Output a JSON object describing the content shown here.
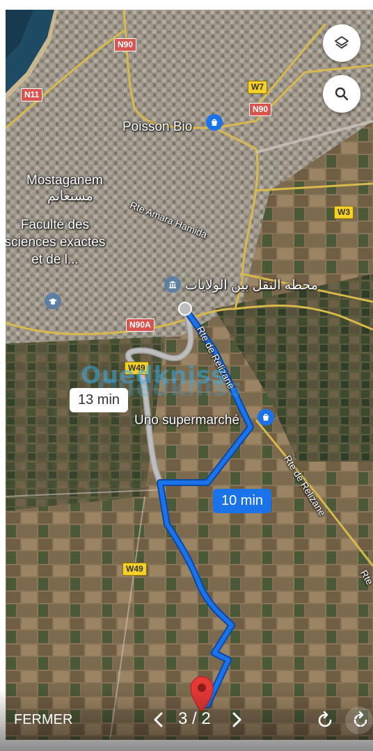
{
  "map": {
    "places": {
      "poisson_bio": "Poisson Bio",
      "mostaganem": "Mostaganem",
      "mostaganem_ar": "مستغانم",
      "faculte": "Faculté des sciences exactes et de l...",
      "gare_ar": "محطة النقل بين الولايات",
      "uno": "Uno supermarché"
    },
    "roads": {
      "rte_amara": "Rte Amara Hamida",
      "rte_relizane_1": "Rte de Relizane",
      "rte_relizane_2": "Rte de Relizane",
      "rte_relizane_3": "Rte"
    },
    "shields": {
      "n90_top": "N90",
      "n11": "N11",
      "w7": "W7",
      "n90_right": "N90",
      "w3": "W3",
      "n90a": "N90A",
      "w49_top": "W49",
      "w49_bottom": "W49"
    },
    "routes": {
      "alt_time": "13 min",
      "main_time": "10 min"
    },
    "watermark": "Ouedkniss"
  },
  "controls": {
    "layers_icon": "layers-icon",
    "search_icon": "search-icon"
  },
  "viewer": {
    "close_label": "FERMER",
    "counter": "3 / 2",
    "prev_icon": "chevron-left-icon",
    "next_icon": "chevron-right-icon",
    "rotate_icon": "rotate-icon"
  },
  "colors": {
    "route_main": "#1a73e8",
    "route_alt": "#bdbdbd",
    "pin": "#e53935",
    "shield_red": "#d9534f",
    "shield_yellow": "#f5d029"
  }
}
